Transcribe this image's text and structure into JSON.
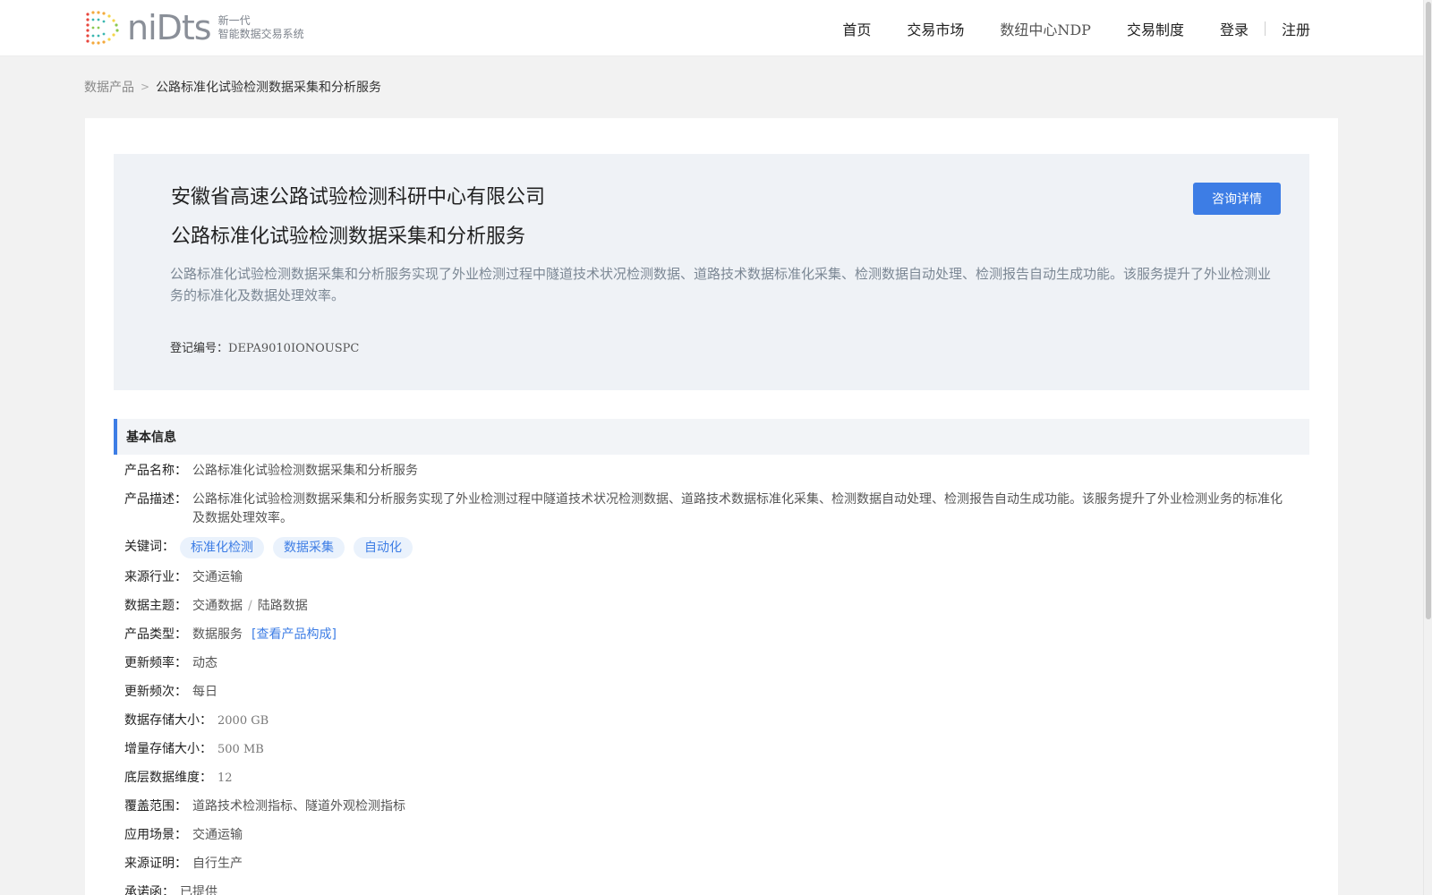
{
  "header": {
    "logo_word": "niDts",
    "logo_sub_line1": "新一代",
    "logo_sub_line2": "智能数据交易系统",
    "nav": [
      "首页",
      "交易市场",
      "数纽中心NDP",
      "交易制度"
    ],
    "login": "登录",
    "register": "注册"
  },
  "breadcrumb": {
    "root": "数据产品",
    "separator": ">",
    "current": "公路标准化试验检测数据采集和分析服务"
  },
  "hero": {
    "company": "安徽省高速公路试验检测科研中心有限公司",
    "title": "公路标准化试验检测数据采集和分析服务",
    "description": "公路标准化试验检测数据采集和分析服务实现了外业检测过程中隧道技术状况检测数据、道路技术数据标准化采集、检测数据自动处理、检测报告自动生成功能。该服务提升了外业检测业务的标准化及数据处理效率。",
    "reg_label": "登记编号：",
    "reg_value": "DEPA9010IONOUSPC",
    "consult_button": "咨询详情"
  },
  "basic_info": {
    "heading": "基本信息",
    "name_label": "产品名称：",
    "name_value": "公路标准化试验检测数据采集和分析服务",
    "desc_label": "产品描述：",
    "desc_value": "公路标准化试验检测数据采集和分析服务实现了外业检测过程中隧道技术状况检测数据、道路技术数据标准化采集、检测数据自动处理、检测报告自动生成功能。该服务提升了外业检测业务的标准化及数据处理效率。",
    "keywords_label": "关键词：",
    "keywords": [
      "标准化检测",
      "数据采集",
      "自动化"
    ],
    "industry_label": "来源行业：",
    "industry_value": "交通运输",
    "theme_label": "数据主题：",
    "theme_value1": "交通数据",
    "theme_sep": "/",
    "theme_value2": "陆路数据",
    "type_label": "产品类型：",
    "type_value": "数据服务",
    "type_link": "[查看产品构成]",
    "freq_label": "更新频率：",
    "freq_value": "动态",
    "times_label": "更新频次：",
    "times_value": "每日",
    "storage_label": "数据存储大小：",
    "storage_value": "2000 GB",
    "inc_label": "增量存储大小：",
    "inc_value": "500 MB",
    "dim_label": "底层数据维度：",
    "dim_value": "12",
    "coverage_label": "覆盖范围：",
    "coverage_value": "道路技术检测指标、隧道外观检测指标",
    "scene_label": "应用场景：",
    "scene_value": "交通运输",
    "proof_label": "来源证明：",
    "proof_value": "自行生产",
    "promise_label": "承诺函：",
    "promise_value": "已提供"
  },
  "colors": {
    "accent": "#3d7de5",
    "hero_bg": "#eff2f6",
    "page_bg": "#f2f2f2"
  }
}
